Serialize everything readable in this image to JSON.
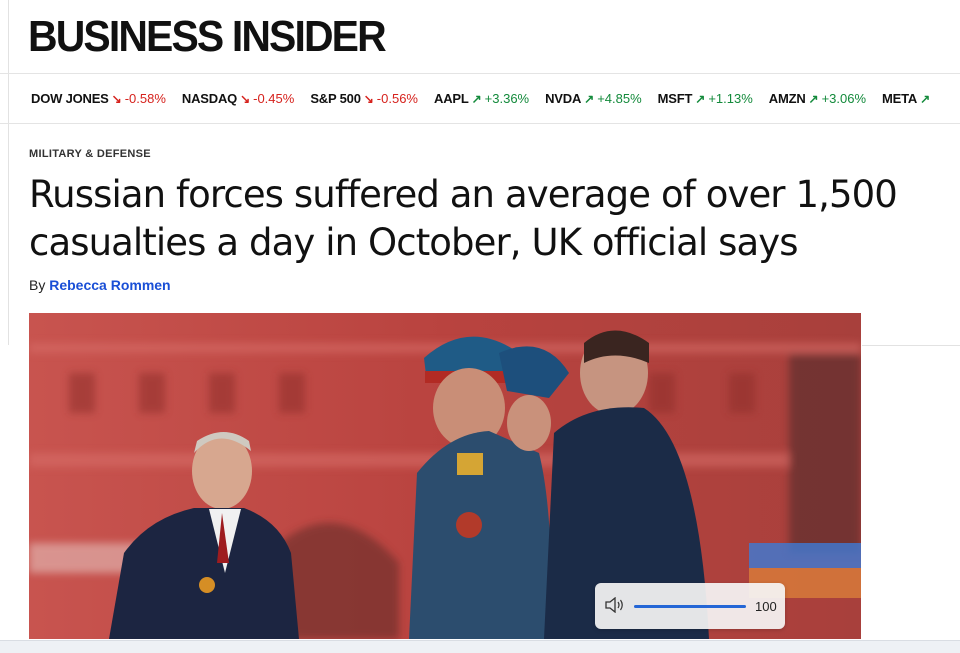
{
  "header": {
    "logo": "BUSINESS INSIDER"
  },
  "ticker": [
    {
      "symbol": "DOW JONES",
      "direction": "down",
      "change": "-0.58%"
    },
    {
      "symbol": "NASDAQ",
      "direction": "down",
      "change": "-0.45%"
    },
    {
      "symbol": "S&P 500",
      "direction": "down",
      "change": "-0.56%"
    },
    {
      "symbol": "AAPL",
      "direction": "up",
      "change": "+3.36%"
    },
    {
      "symbol": "NVDA",
      "direction": "up",
      "change": "+4.85%"
    },
    {
      "symbol": "MSFT",
      "direction": "up",
      "change": "+1.13%"
    },
    {
      "symbol": "AMZN",
      "direction": "up",
      "change": "+3.06%"
    },
    {
      "symbol": "META",
      "direction": "up",
      "change": ""
    }
  ],
  "article": {
    "category": "MILITARY & DEFENSE",
    "headline": "Russian forces suffered an average of over 1,500 casualties a day in October, UK official says",
    "by": "By",
    "author": "Rebecca Rommen"
  },
  "media_control": {
    "volume_label": "100",
    "volume": 100
  },
  "colors": {
    "down": "#d6221d",
    "up": "#138a3b",
    "author_link": "#1a4fd6",
    "slider": "#2466d6"
  },
  "icons": {
    "down_arrow": "arrow-down-right-icon",
    "up_arrow": "arrow-up-right-icon",
    "volume": "speaker-icon"
  }
}
